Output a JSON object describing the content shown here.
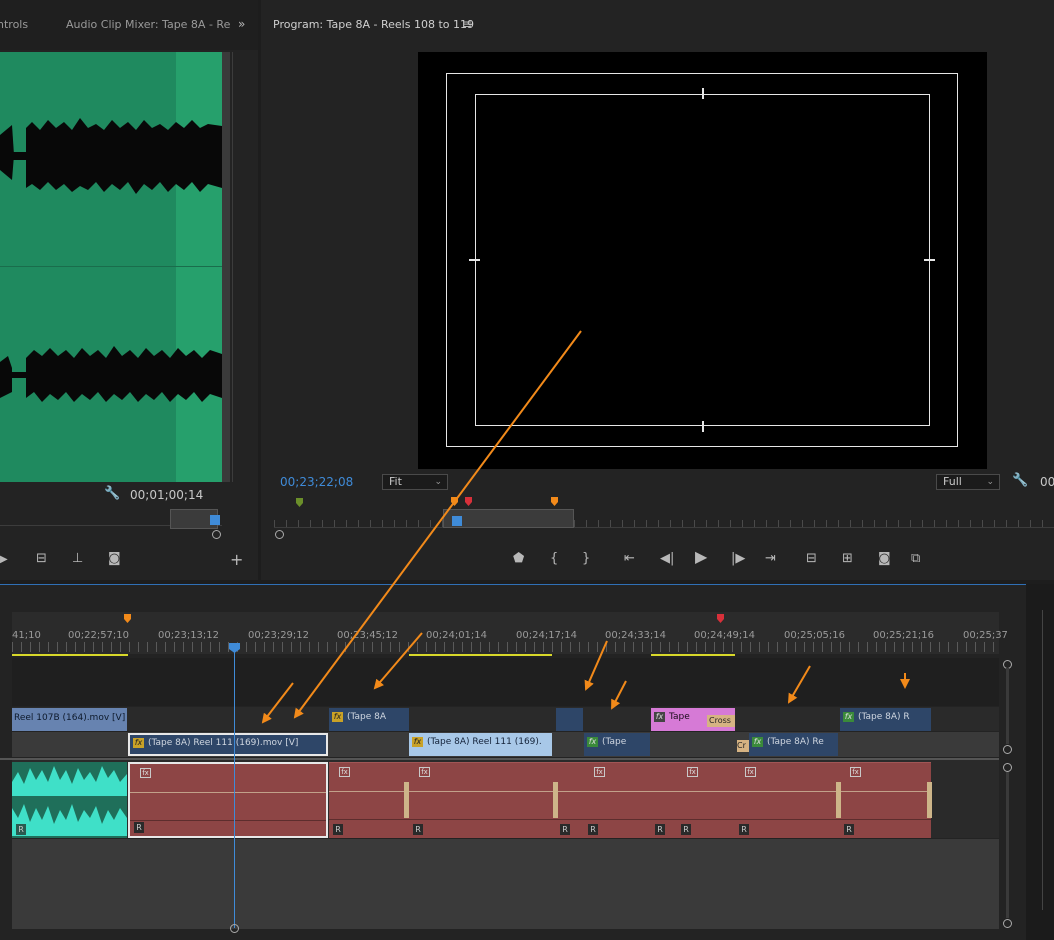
{
  "source_panel": {
    "tab_controls": "ntrols",
    "tab_audio_mixer": "Audio Clip Mixer: Tape 8A - Re",
    "overflow_icon": "double-chevron-right",
    "timecode": "00;01;00;14"
  },
  "program_panel": {
    "title": "Program: Tape 8A - Reels 108 to 119",
    "menu_icon": "hamburger",
    "timecode": "00;23;22;08",
    "fit_label": "Fit",
    "full_label": "Full",
    "right_timecode": "00"
  },
  "transport": {
    "buttons": [
      "marker",
      "mark-in",
      "mark-out",
      "go-to-in",
      "step-back",
      "play",
      "step-forward",
      "go-to-out",
      "lift",
      "extract",
      "export-frame",
      "compare"
    ]
  },
  "timeline": {
    "ruler_labels": [
      "41;10",
      "00;22;57;10",
      "00;23;13;12",
      "00;23;29;12",
      "00;23;45;12",
      "00;24;01;14",
      "00;24;17;14",
      "00;24;33;14",
      "00;24;49;14",
      "00;25;05;16",
      "00;25;21;16",
      "00;25;37"
    ],
    "v2_clips": [
      {
        "label": "Reel 107B (164).mov [V]"
      },
      {
        "label": "(Tape 8A"
      },
      {
        "label": "Tape"
      },
      {
        "label": "Cross"
      },
      {
        "label": "(Tape 8A) R"
      }
    ],
    "v1_clips": [
      {
        "label": "(Tape 8A) Reel 111 (169).mov [V]"
      },
      {
        "label": "(Tape 8A) Reel 111 (169)."
      },
      {
        "label": "(Tape"
      },
      {
        "label": "(Tape 8A) Re"
      },
      {
        "label": "Cr"
      }
    ],
    "audio_r_label": "R",
    "audio_fx_label": "fx"
  },
  "colors": {
    "accent_blue": "#3f8bd8",
    "arrow_orange": "#f28a1a",
    "audio_green": "#1f8a5f",
    "audio_clip_red": "#8d4545",
    "video_clip_blue": "#2e4668"
  }
}
